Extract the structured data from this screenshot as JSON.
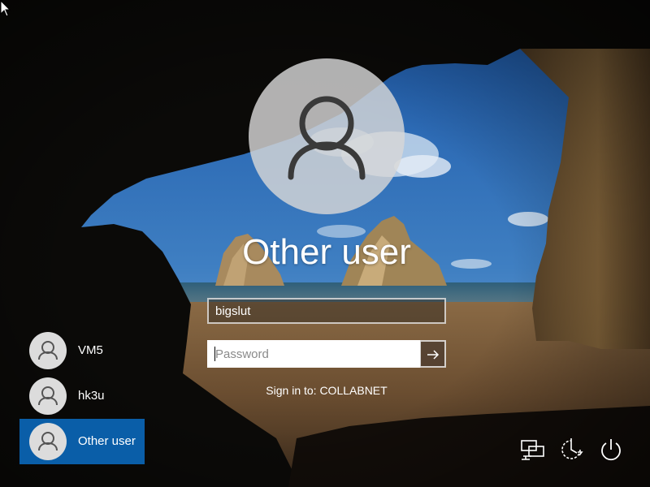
{
  "main_user": {
    "name": "Other user",
    "avatar_icon": "person-icon"
  },
  "form": {
    "username_value": "bigslut",
    "password_placeholder": "Password",
    "password_value": "",
    "submit_icon": "arrow-right-icon"
  },
  "sign_in_to": "Sign in to: COLLABNET",
  "user_list": [
    {
      "label": "VM5",
      "selected": false
    },
    {
      "label": "hk3u",
      "selected": false
    },
    {
      "label": "Other user",
      "selected": true
    }
  ],
  "system_icons": [
    "network-icon",
    "ease-of-access-icon",
    "power-icon"
  ],
  "colors": {
    "selection": "#0a5ea8",
    "text": "#ffffff"
  }
}
